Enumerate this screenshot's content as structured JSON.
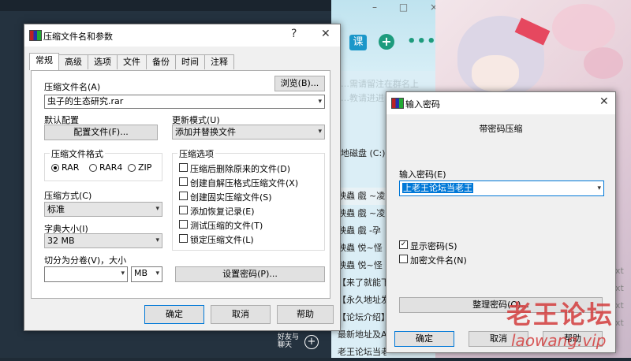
{
  "background": {
    "chat_icons": {
      "course": "课",
      "add": "+",
      "more": "•••"
    },
    "chat_window_controls": "– □ ×",
    "chat_faint_lines": [
      "…需请留注在群名上",
      "…教请进进"
    ],
    "disk_label": "地磁盘 (C:)",
    "file_rows": [
      "殃蟲 戲 ~凌",
      "殃蟲 戲 ~凌",
      "殃蟲 戲 -孕",
      "殃蟲 悦~怪",
      "殃蟲 悦~怪",
      "【来了就能下",
      "【永久地址发",
      "【论坛介绍】",
      "最新地址及AF",
      "老王论坛当老"
    ],
    "file_ext": [
      "xt",
      "xt",
      "xt",
      "xt"
    ],
    "friends_label_1": "好友与",
    "friends_label_2": "聊天",
    "friends_icon": "+"
  },
  "archive_dialog": {
    "title": "压缩文件名和参数",
    "help_btn": "?",
    "close_btn": "✕",
    "tabs": [
      "常规",
      "高级",
      "选项",
      "文件",
      "备份",
      "时间",
      "注释"
    ],
    "archive_name_label": "压缩文件名(A)",
    "browse_button": "浏览(B)...",
    "archive_name_value": "虫子的生态研究.rar",
    "default_config_label": "默认配置",
    "profiles_button": "配置文件(F)...",
    "update_mode_label": "更新模式(U)",
    "update_mode_value": "添加并替换文件",
    "format_group": "压缩文件格式",
    "formats": [
      "RAR",
      "RAR4",
      "ZIP"
    ],
    "selected_format": "RAR",
    "method_label": "压缩方式(C)",
    "method_value": "标准",
    "dict_label": "字典大小(I)",
    "dict_value": "32 MB",
    "split_label": "切分为分卷(V)，大小",
    "split_unit": "MB",
    "options_group": "压缩选项",
    "options": [
      {
        "label": "压缩后删除原来的文件(D)",
        "checked": false
      },
      {
        "label": "创建自解压格式压缩文件(X)",
        "checked": false
      },
      {
        "label": "创建固实压缩文件(S)",
        "checked": false
      },
      {
        "label": "添加恢复记录(E)",
        "checked": false
      },
      {
        "label": "测试压缩的文件(T)",
        "checked": false
      },
      {
        "label": "锁定压缩文件(L)",
        "checked": false
      }
    ],
    "set_password_button": "设置密码(P)...",
    "ok_button": "确定",
    "cancel_button": "取消",
    "help_button": "帮助"
  },
  "password_dialog": {
    "title": "输入密码",
    "close_btn": "✕",
    "heading": "带密码压缩",
    "enter_password_label": "输入密码(E)",
    "password_value": "上老王论坛当老王",
    "show_password_label": "显示密码(S)",
    "show_password_checked": true,
    "encrypt_names_label": "加密文件名(N)",
    "encrypt_names_checked": false,
    "organize_button": "整理密码(O)...",
    "ok_button": "确定",
    "cancel_button": "取消",
    "help_button": "帮助"
  },
  "watermark": {
    "text_cn": "老王论坛",
    "text_url": "laowang.vip"
  }
}
